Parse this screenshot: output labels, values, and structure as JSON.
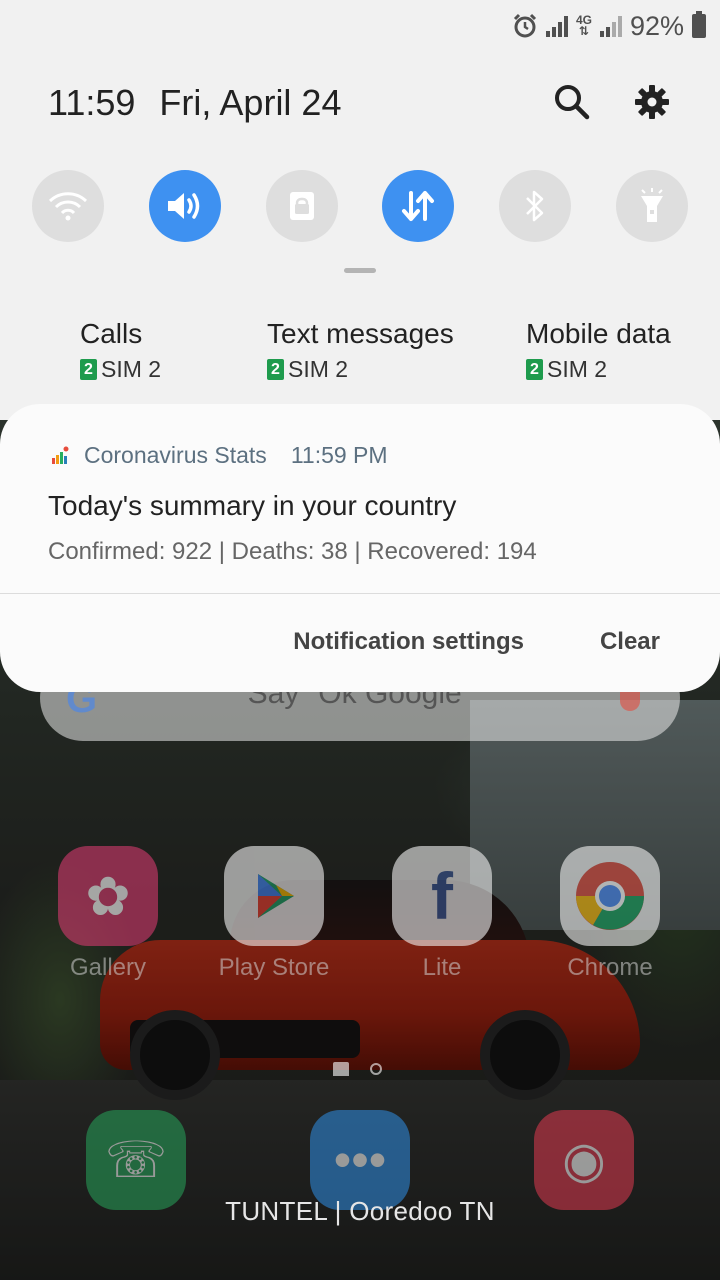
{
  "status_bar": {
    "network_type": "4G",
    "battery_percent": "92%"
  },
  "header": {
    "time": "11:59",
    "date": "Fri, April 24"
  },
  "quick_toggles": [
    {
      "name": "wifi",
      "icon": "wifi-icon",
      "active": false
    },
    {
      "name": "sound",
      "icon": "volume-icon",
      "active": true
    },
    {
      "name": "rotation-lock",
      "icon": "lock-icon",
      "active": false
    },
    {
      "name": "mobile-data",
      "icon": "data-transfer-icon",
      "active": true
    },
    {
      "name": "bluetooth",
      "icon": "bluetooth-icon",
      "active": false
    },
    {
      "name": "flashlight",
      "icon": "flashlight-icon",
      "active": false
    }
  ],
  "sim_preferences": [
    {
      "title": "Calls",
      "sim_badge": "2",
      "sim_label": "SIM 2"
    },
    {
      "title": "Text messages",
      "sim_badge": "2",
      "sim_label": "SIM 2"
    },
    {
      "title": "Mobile data",
      "sim_badge": "2",
      "sim_label": "SIM 2"
    }
  ],
  "notification": {
    "app_name": "Coronavirus Stats",
    "time": "11:59 PM",
    "title": "Today's summary in your country",
    "body": "Confirmed: 922 | Deaths: 38 | Recovered: 194",
    "actions": {
      "settings": "Notification settings",
      "clear": "Clear"
    }
  },
  "home_screen": {
    "search_placeholder": "Say \"Ok Google\"",
    "apps": [
      {
        "label": "Gallery",
        "color": "#d43a6e"
      },
      {
        "label": "Play Store",
        "color": "#f2f2f2"
      },
      {
        "label": "Lite",
        "color": "#3b5998"
      },
      {
        "label": "Chrome",
        "color": "#ffffff"
      }
    ],
    "dock": [
      {
        "name": "phone",
        "color": "#27a55b"
      },
      {
        "name": "messages",
        "color": "#2f8fe6"
      },
      {
        "name": "camera",
        "color": "#e03a50"
      }
    ]
  },
  "carrier": "TUNTEL | Ooredoo TN",
  "colors": {
    "accent": "#3e91f1",
    "sim_badge": "#1e9b4d"
  }
}
